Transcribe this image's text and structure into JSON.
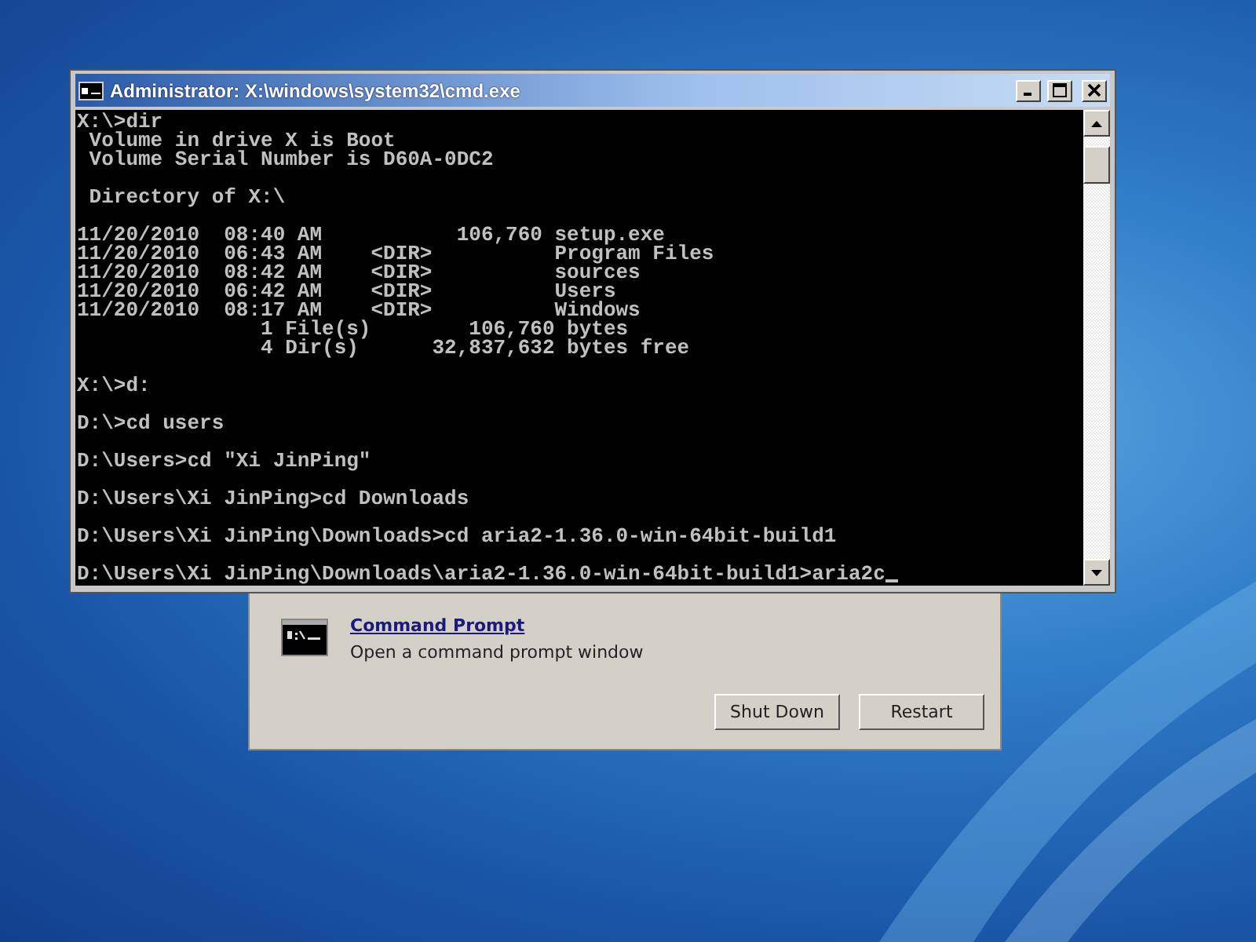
{
  "recovery_dialog": {
    "tool": {
      "title": "Command Prompt",
      "description": "Open a command prompt window"
    },
    "buttons": [
      "Shut Down",
      "Restart"
    ]
  },
  "cmd_window": {
    "title": "Administrator: X:\\windows\\system32\\cmd.exe",
    "blocks": [
      [
        "X:\\>dir",
        " Volume in drive X is Boot",
        " Volume Serial Number is D60A-0DC2"
      ],
      [
        " Directory of X:\\"
      ],
      [
        "11/20/2010  08:40 AM           106,760 setup.exe",
        "11/20/2010  06:43 AM    <DIR>          Program Files",
        "11/20/2010  08:42 AM    <DIR>          sources",
        "11/20/2010  06:42 AM    <DIR>          Users",
        "11/20/2010  08:17 AM    <DIR>          Windows",
        "               1 File(s)        106,760 bytes",
        "               4 Dir(s)      32,837,632 bytes free"
      ],
      [
        "X:\\>d:"
      ],
      [
        "D:\\>cd users"
      ],
      [
        "D:\\Users>cd \"Xi JinPing\""
      ],
      [
        "D:\\Users\\Xi JinPing>cd Downloads"
      ],
      [
        "D:\\Users\\Xi JinPing\\Downloads>cd aria2-1.36.0-win-64bit-build1"
      ],
      [
        "D:\\Users\\Xi JinPing\\Downloads\\aria2-1.36.0-win-64bit-build1>aria2c"
      ]
    ]
  }
}
